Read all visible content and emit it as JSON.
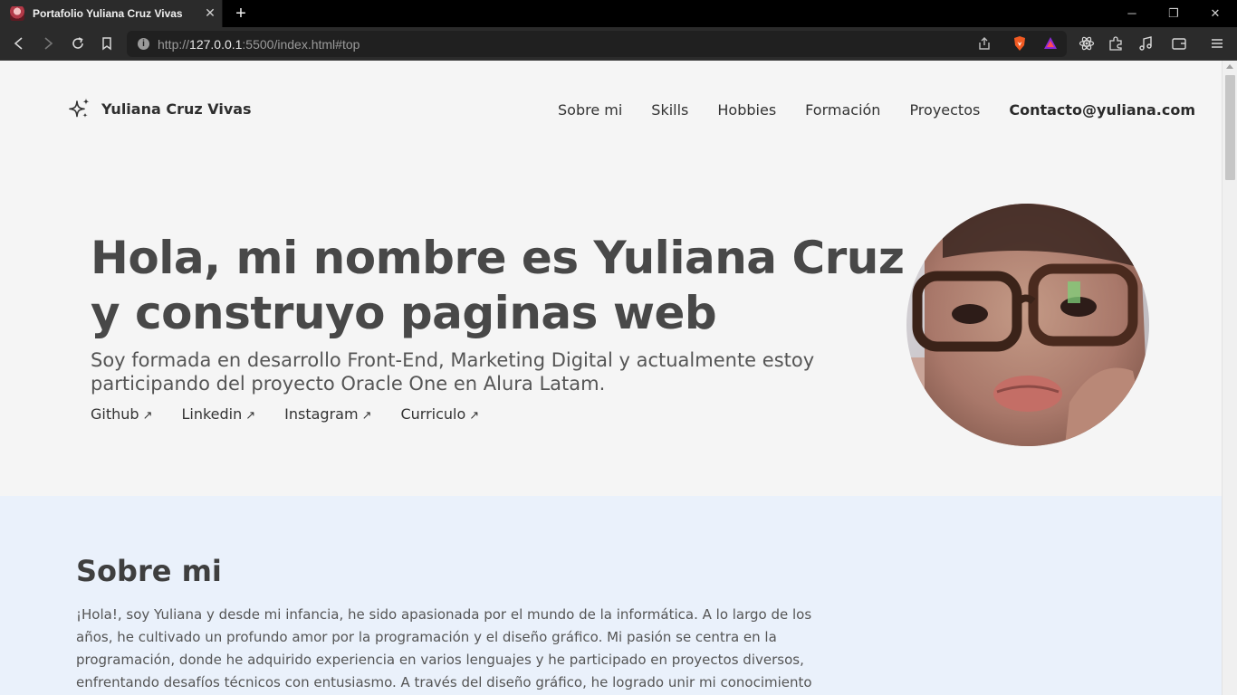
{
  "browser": {
    "tab_title": "Portafolio Yuliana Cruz Vivas",
    "url_prefix": "http://",
    "url_host": "127.0.0.1",
    "url_rest": ":5500/index.html#top"
  },
  "header": {
    "brand": "Yuliana Cruz Vivas",
    "nav": [
      "Sobre mi",
      "Skills",
      "Hobbies",
      "Formación",
      "Proyectos"
    ],
    "contact": "Contacto@yuliana.com"
  },
  "hero": {
    "title": "Hola, mi nombre es Yuliana Cruz y construyo paginas web",
    "subtitle": "Soy formada en desarrollo Front-End, Marketing Digital y actualmente estoy participando del proyecto Oracle One en Alura Latam.",
    "links": [
      "Github",
      "Linkedin",
      "Instagram",
      "Curriculo"
    ],
    "link_arrow": "↗"
  },
  "about": {
    "title": "Sobre mi",
    "text": "¡Hola!, soy Yuliana y desde mi infancia, he sido apasionada por el mundo de la informática. A lo largo de los años, he cultivado un profundo amor por la programación y el diseño gráfico. Mi pasión se centra en la programación, donde he adquirido experiencia en varios lenguajes y he participado en proyectos diversos, enfrentando desafíos técnicos con entusiasmo. A través del diseño gráfico, he logrado unir mi conocimiento técnico con mi"
  },
  "colors": {
    "page_bg": "#f5f5f5",
    "about_bg": "#eaf1fb",
    "text_dark": "#484848",
    "chrome_bg": "#2b2b2b"
  }
}
